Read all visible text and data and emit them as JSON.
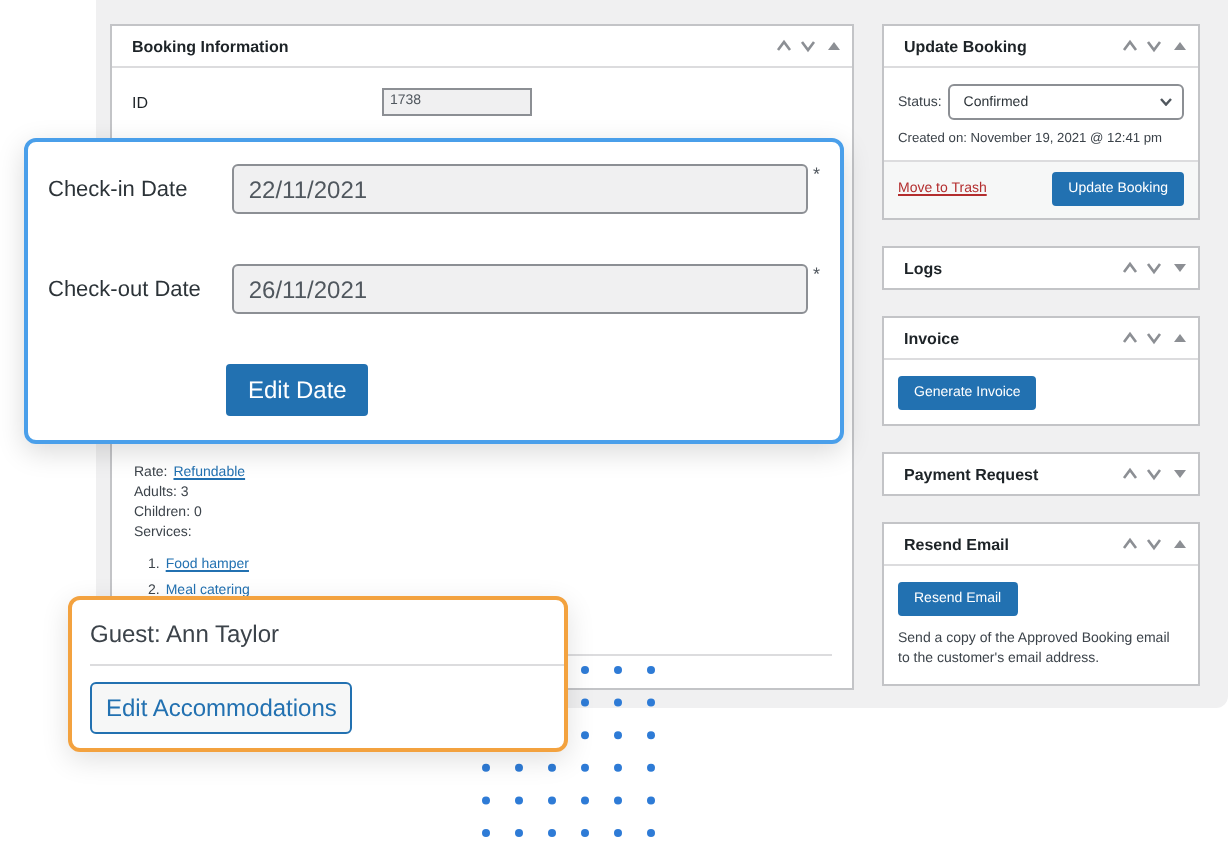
{
  "booking_panel": {
    "title": "Booking Information",
    "expanded": true,
    "id_label": "ID",
    "id_value": "1738",
    "rate": {
      "label": "Rate:",
      "link": "Refundable"
    },
    "details": [
      "Adults: 3",
      "Children: 0",
      "Services:"
    ],
    "services": [
      {
        "number": "1.",
        "name": "Food hamper"
      },
      {
        "number": "2.",
        "name": "Meal catering"
      }
    ]
  },
  "sidebar_panels": [
    {
      "kind": "update",
      "title": "Update Booking",
      "expanded": true,
      "status_label": "Status:",
      "status_value": "Confirmed",
      "created": "Created on: November 19, 2021 @ 12:41 pm",
      "trash_link": "Move to Trash",
      "button": "Update Booking"
    },
    {
      "title": "Logs",
      "expanded": false
    },
    {
      "kind": "button",
      "title": "Invoice",
      "expanded": true,
      "button": "Generate Invoice"
    },
    {
      "title": "Payment Request",
      "expanded": false
    },
    {
      "kind": "resend",
      "title": "Resend Email",
      "expanded": true,
      "button": "Resend Email",
      "note": "Send a copy of the Approved Booking email to the customer's email address."
    }
  ],
  "date_card": {
    "fields": [
      {
        "label": "Check-in Date",
        "value": "22/11/2021",
        "required_mark": "*"
      },
      {
        "label": "Check-out Date",
        "value": "26/11/2021",
        "required_mark": "*"
      }
    ],
    "button": "Edit Date"
  },
  "guest_card": {
    "guest": "Guest: Ann Taylor",
    "button": "Edit Accommodations"
  }
}
